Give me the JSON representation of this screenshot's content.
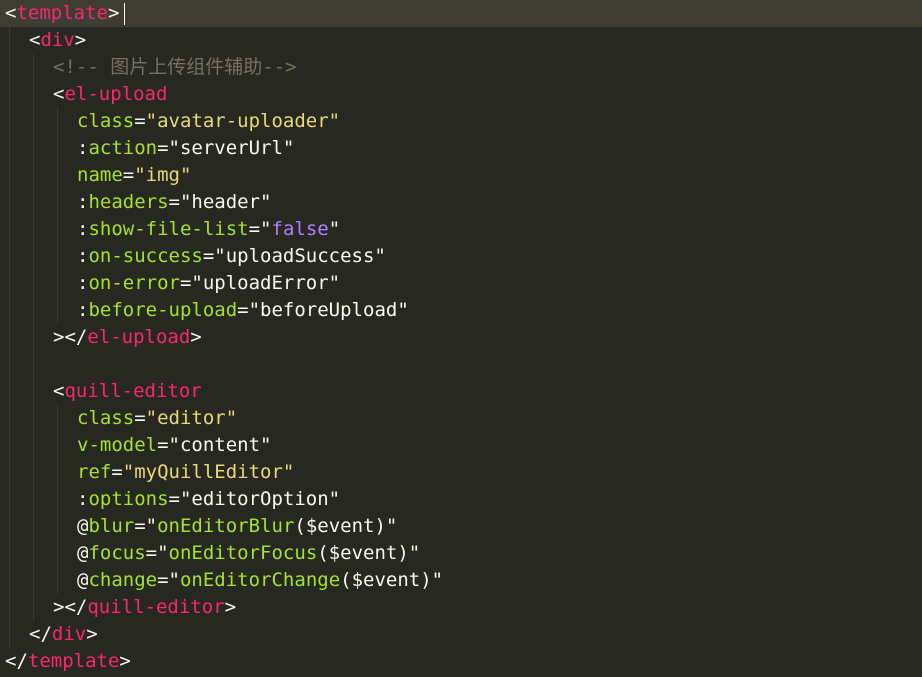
{
  "editor": {
    "language": "vue-template",
    "theme": "Monokai",
    "colors": {
      "background": "#272822",
      "current_line": "#3e3d32",
      "plain": "#f8f8f2",
      "tag": "#f92672",
      "attribute": "#a6e22e",
      "string": "#e6db74",
      "boolean": "#ae81ff",
      "comment": "#75715e"
    },
    "lines": [
      {
        "indent": 0,
        "current": true,
        "tokens": [
          {
            "t": "<",
            "c": "plain"
          },
          {
            "t": "template",
            "c": "tag"
          },
          {
            "t": ">",
            "c": "plain"
          }
        ]
      },
      {
        "indent": 1,
        "tokens": [
          {
            "t": "<",
            "c": "plain"
          },
          {
            "t": "div",
            "c": "tag"
          },
          {
            "t": ">",
            "c": "plain"
          }
        ]
      },
      {
        "indent": 2,
        "tokens": [
          {
            "t": "<!-- 图片上传组件辅助-->",
            "c": "comment"
          }
        ]
      },
      {
        "indent": 2,
        "tokens": [
          {
            "t": "<",
            "c": "plain"
          },
          {
            "t": "el-upload",
            "c": "tag"
          }
        ]
      },
      {
        "indent": 3,
        "tokens": [
          {
            "t": "class",
            "c": "attr"
          },
          {
            "t": "=",
            "c": "plain"
          },
          {
            "t": "\"avatar-uploader\"",
            "c": "str"
          }
        ]
      },
      {
        "indent": 3,
        "tokens": [
          {
            "t": ":",
            "c": "plain"
          },
          {
            "t": "action",
            "c": "attr"
          },
          {
            "t": "=\"serverUrl\"",
            "c": "plain"
          }
        ]
      },
      {
        "indent": 3,
        "tokens": [
          {
            "t": "name",
            "c": "attr"
          },
          {
            "t": "=",
            "c": "plain"
          },
          {
            "t": "\"img\"",
            "c": "str"
          }
        ]
      },
      {
        "indent": 3,
        "tokens": [
          {
            "t": ":",
            "c": "plain"
          },
          {
            "t": "headers",
            "c": "attr"
          },
          {
            "t": "=\"header\"",
            "c": "plain"
          }
        ]
      },
      {
        "indent": 3,
        "tokens": [
          {
            "t": ":",
            "c": "plain"
          },
          {
            "t": "show-file-list",
            "c": "attr"
          },
          {
            "t": "=\"",
            "c": "plain"
          },
          {
            "t": "false",
            "c": "bool"
          },
          {
            "t": "\"",
            "c": "plain"
          }
        ]
      },
      {
        "indent": 3,
        "tokens": [
          {
            "t": ":",
            "c": "plain"
          },
          {
            "t": "on-success",
            "c": "attr"
          },
          {
            "t": "=\"uploadSuccess\"",
            "c": "plain"
          }
        ]
      },
      {
        "indent": 3,
        "tokens": [
          {
            "t": ":",
            "c": "plain"
          },
          {
            "t": "on-error",
            "c": "attr"
          },
          {
            "t": "=\"uploadError\"",
            "c": "plain"
          }
        ]
      },
      {
        "indent": 3,
        "tokens": [
          {
            "t": ":",
            "c": "plain"
          },
          {
            "t": "before-upload",
            "c": "attr"
          },
          {
            "t": "=\"beforeUpload\"",
            "c": "plain"
          }
        ]
      },
      {
        "indent": 2,
        "tokens": [
          {
            "t": "></",
            "c": "plain"
          },
          {
            "t": "el-upload",
            "c": "tag"
          },
          {
            "t": ">",
            "c": "plain"
          }
        ]
      },
      {
        "indent": 0,
        "tokens": []
      },
      {
        "indent": 2,
        "tokens": [
          {
            "t": "<",
            "c": "plain"
          },
          {
            "t": "quill-editor",
            "c": "tag"
          }
        ]
      },
      {
        "indent": 3,
        "tokens": [
          {
            "t": "class",
            "c": "attr"
          },
          {
            "t": "=",
            "c": "plain"
          },
          {
            "t": "\"editor\"",
            "c": "str"
          }
        ]
      },
      {
        "indent": 3,
        "tokens": [
          {
            "t": "v-model",
            "c": "attr"
          },
          {
            "t": "=\"content\"",
            "c": "plain"
          }
        ]
      },
      {
        "indent": 3,
        "tokens": [
          {
            "t": "ref",
            "c": "attr"
          },
          {
            "t": "=",
            "c": "plain"
          },
          {
            "t": "\"myQuillEditor\"",
            "c": "str"
          }
        ]
      },
      {
        "indent": 3,
        "tokens": [
          {
            "t": ":",
            "c": "plain"
          },
          {
            "t": "options",
            "c": "attr"
          },
          {
            "t": "=\"editorOption\"",
            "c": "plain"
          }
        ]
      },
      {
        "indent": 3,
        "tokens": [
          {
            "t": "@",
            "c": "plain"
          },
          {
            "t": "blur",
            "c": "attr"
          },
          {
            "t": "=\"",
            "c": "plain"
          },
          {
            "t": "onEditorBlur",
            "c": "attr"
          },
          {
            "t": "($event)\"",
            "c": "plain"
          }
        ]
      },
      {
        "indent": 3,
        "tokens": [
          {
            "t": "@",
            "c": "plain"
          },
          {
            "t": "focus",
            "c": "attr"
          },
          {
            "t": "=\"",
            "c": "plain"
          },
          {
            "t": "onEditorFocus",
            "c": "attr"
          },
          {
            "t": "($event)\"",
            "c": "plain"
          }
        ]
      },
      {
        "indent": 3,
        "tokens": [
          {
            "t": "@",
            "c": "plain"
          },
          {
            "t": "change",
            "c": "attr"
          },
          {
            "t": "=\"",
            "c": "plain"
          },
          {
            "t": "onEditorChange",
            "c": "attr"
          },
          {
            "t": "($event)\"",
            "c": "plain"
          }
        ]
      },
      {
        "indent": 2,
        "tokens": [
          {
            "t": "></",
            "c": "plain"
          },
          {
            "t": "quill-editor",
            "c": "tag"
          },
          {
            "t": ">",
            "c": "plain"
          }
        ]
      },
      {
        "indent": 1,
        "tokens": [
          {
            "t": "</",
            "c": "plain"
          },
          {
            "t": "div",
            "c": "tag"
          },
          {
            "t": ">",
            "c": "plain"
          }
        ]
      },
      {
        "indent": 0,
        "tokens": [
          {
            "t": "</",
            "c": "plain"
          },
          {
            "t": "template",
            "c": "tag"
          },
          {
            "t": ">",
            "c": "plain"
          }
        ]
      }
    ]
  }
}
